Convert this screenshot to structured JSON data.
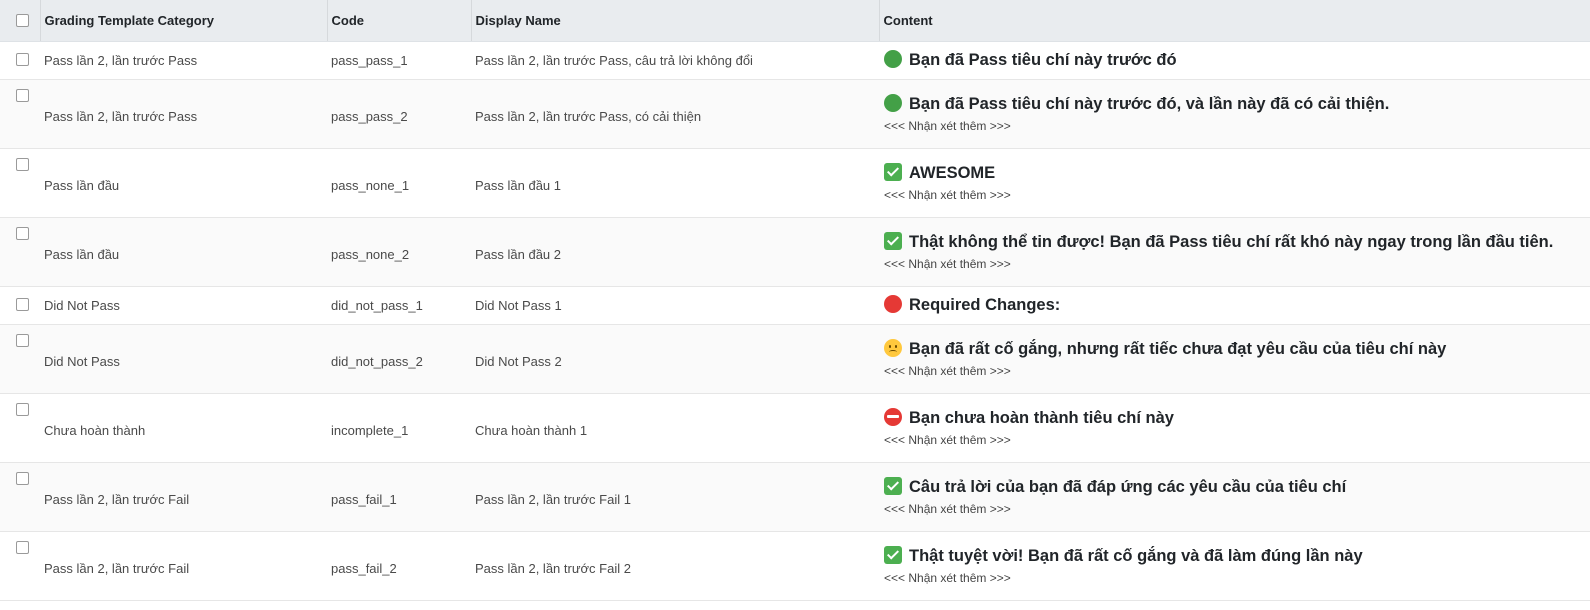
{
  "table": {
    "headers": {
      "category": "Grading Template Category",
      "code": "Code",
      "display_name": "Display Name",
      "content": "Content"
    },
    "rows": [
      {
        "category": "Pass lần 2, lần trước Pass",
        "code": "pass_pass_1",
        "display_name": "Pass lần 2, lần trước Pass, câu trả lời không đổi",
        "icon": "green-circle-icon",
        "title": "Bạn đã Pass tiêu chí này trước đó",
        "note": ""
      },
      {
        "category": "Pass lần 2, lần trước Pass",
        "code": "pass_pass_2",
        "display_name": "Pass lần 2, lần trước Pass, có cải thiện",
        "icon": "green-circle-icon",
        "title": "Bạn đã Pass tiêu chí này trước đó, và lần này đã có cải thiện.",
        "note": "<<< Nhận xét thêm >>>"
      },
      {
        "category": "Pass lần đầu",
        "code": "pass_none_1",
        "display_name": "Pass lần đầu 1",
        "icon": "check-mark-icon",
        "title": "AWESOME",
        "note": "<<< Nhận xét thêm >>>"
      },
      {
        "category": "Pass lần đầu",
        "code": "pass_none_2",
        "display_name": "Pass lần đầu 2",
        "icon": "check-mark-icon",
        "title": "Thật không thể tin được! Bạn đã Pass tiêu chí rất khó này ngay trong lần đầu tiên.",
        "note": "<<< Nhận xét thêm >>>"
      },
      {
        "category": "Did Not Pass",
        "code": "did_not_pass_1",
        "display_name": "Did Not Pass 1",
        "icon": "red-circle-icon",
        "title": "Required Changes:",
        "note": ""
      },
      {
        "category": "Did Not Pass",
        "code": "did_not_pass_2",
        "display_name": "Did Not Pass 2",
        "icon": "worried-face-icon",
        "title": "Bạn đã rất cố gắng, nhưng rất tiếc chưa đạt yêu cầu của tiêu chí này",
        "note": "<<< Nhận xét thêm >>>"
      },
      {
        "category": "Chưa hoàn thành",
        "code": "incomplete_1",
        "display_name": "Chưa hoàn thành 1",
        "icon": "no-entry-icon",
        "title": "Bạn chưa hoàn thành tiêu chí này",
        "note": "<<< Nhận xét thêm >>>"
      },
      {
        "category": "Pass lần 2, lần trước Fail",
        "code": "pass_fail_1",
        "display_name": "Pass lần 2, lần trước Fail 1",
        "icon": "check-mark-icon",
        "title": "Câu trả lời của bạn đã đáp ứng các yêu cầu của tiêu chí",
        "note": "<<< Nhận xét thêm >>>"
      },
      {
        "category": "Pass lần 2, lần trước Fail",
        "code": "pass_fail_2",
        "display_name": "Pass lần 2, lần trước Fail 2",
        "icon": "check-mark-icon",
        "title": "Thật tuyệt vời! Bạn đã rất cố gắng và đã làm đúng lần này",
        "note": "<<< Nhận xét thêm >>>"
      }
    ]
  },
  "colors": {
    "header_bg": "#e9ecef",
    "green_circle": "#43a047",
    "red_circle": "#e53935",
    "check_green": "#4caf50"
  }
}
